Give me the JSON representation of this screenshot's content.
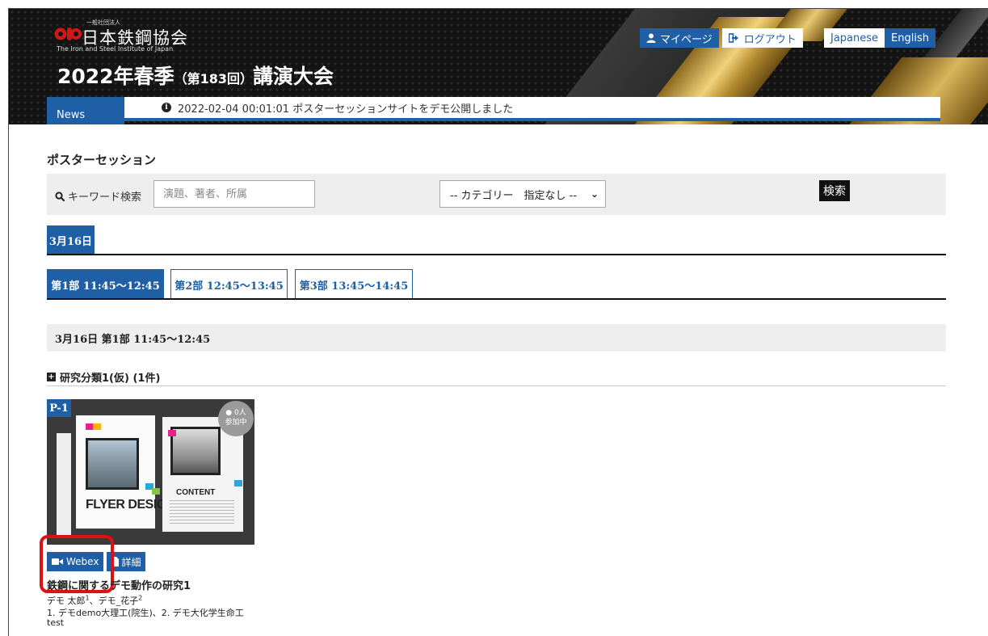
{
  "header": {
    "logo_small": "一般社団法人",
    "logo_name": "日本鉄鋼協会",
    "logo_en": "The Iron and Steel Institute of Japan",
    "event_title_a": "2022年春季",
    "event_title_b": "（第183回）",
    "event_title_c": "講演大会",
    "mypage_label": "マイページ",
    "logout_label": "ログアウト",
    "lang_ja": "Japanese",
    "lang_en": "English"
  },
  "news": {
    "tab_label": "News",
    "message": "2022-02-04 00:01:01 ポスターセッションサイトをデモ公開しました"
  },
  "main": {
    "section_title": "ポスターセッション",
    "search_label": "キーワード検索",
    "search_placeholder": "演題、著者、所属",
    "category_selected": "-- カテゴリー　指定なし --",
    "search_button": "検索",
    "date_tab": "3月16日",
    "part_tabs": [
      {
        "label": "第1部 11:45〜12:45",
        "active": true
      },
      {
        "label": "第2部 12:45〜13:45",
        "active": false
      },
      {
        "label": "第3部 13:45〜14:45",
        "active": false
      }
    ],
    "schedule_heading": "3月16日 第1部 11:45〜12:45",
    "group_heading": "研究分類1(仮) (1件)"
  },
  "poster": {
    "id": "P-1",
    "participants_count": "0人",
    "participants_label": "参加中",
    "thumb_text_1": "FLYER DESIGN",
    "thumb_text_2": "CONTENT",
    "webex_label": "Webex",
    "detail_label": "詳細",
    "title": "鉄鋼に関するデモ動作の研究1",
    "author1": "デモ 太郎",
    "author1_sup": "1",
    "author_sep": "、デモ_花子",
    "author2_sup": "2",
    "affiliations": "1. デモdemo大理工(院生)、2. デモ大化学生命工",
    "note": "test"
  },
  "colors": {
    "primary": "#1f5fa6",
    "highlight": "#e01010",
    "header_bg": "#141414"
  }
}
